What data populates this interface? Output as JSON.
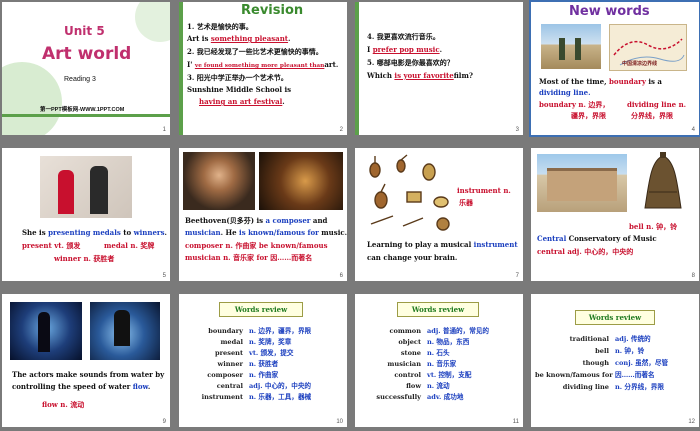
{
  "slides": [
    {
      "num": "1",
      "unit": "Unit 5",
      "title": "Art world",
      "reading": "Reading 3",
      "footer": "第一PPT模板网-WWW.1PPT.COM"
    },
    {
      "num": "2",
      "banner": "Revision",
      "q1": "1. 艺术是愉快的事。",
      "q1a_pre": "Art is ",
      "q1a": "something pleasant",
      "q1a_post": ".",
      "q2": "2. 我已经发现了一些比艺术更愉快的事情。",
      "q2a_pre": "I' ",
      "q2a": "ve found  something more pleasant than",
      "q2a_post": "art.",
      "q3": "3. 阳光中学正举办一个艺术节。",
      "q3b": "Sunshine Middle School is",
      "q3a": "having  an  art festival",
      "q3a_post": "."
    },
    {
      "num": "3",
      "q4": "4. 我更喜欢流行音乐。",
      "q4a_pre": "I ",
      "q4a": "prefer pop music",
      "q4a_post": ".",
      "q5": "5. 哪部电影是你最喜欢的？",
      "q5a_pre": "Which ",
      "q5a": "is your favorite",
      "q5a_post": "film?"
    },
    {
      "num": "4",
      "banner": "New words",
      "map_caption": "中国清凉边界线",
      "l1": "Most of the time, ",
      "l1b": "boundary",
      "l1c": " is a",
      "l2": "dividing line.",
      "w1": "boundary ",
      "w1b": "n. 边界，",
      "w2": "dividing line ",
      "w2b": "n.",
      "w3": "疆界，界限",
      "w4": "分界线，界限"
    },
    {
      "num": "5",
      "l1": "She is ",
      "l1b": "presenting medals",
      "l1c": " to ",
      "l1d": "winners",
      "w1": "present ",
      "w1b": "vt. 颁发",
      "w2": "medal ",
      "w2b": "n. 奖牌",
      "w3": "winner ",
      "w3b": "n. 获胜者"
    },
    {
      "num": "6",
      "l1": "Beethoven(贝多芬) is ",
      "l1b": "a composer",
      "l1c": " and",
      "l2": "musician",
      "l2b": ". He ",
      "l2c": "is known/famous for",
      "l2d": " music.",
      "l3": "composer ",
      "l3b": "n. 作曲家  be known/famous",
      "l4": "musician ",
      "l4b": "n. 音乐家  for  因……而著名"
    },
    {
      "num": "7",
      "w1": "instrument ",
      "w1b": "n.",
      "w2": "乐器",
      "l1": "Learning to play a musical ",
      "l1b": "instrument",
      "l2": "can change your brain."
    },
    {
      "num": "8",
      "w1": "bell ",
      "w1b": "n. 钟，铃",
      "l1": "Central",
      "l1b": " Conservatory of Music",
      "l2": "central ",
      "l2b": "adj. 中心的，中央的"
    },
    {
      "num": "9",
      "l1": "The actors make sounds from water by",
      "l2": "controlling the speed of water ",
      "l2b": "flow",
      "w1": "flow ",
      "w1b": "n. 流动"
    },
    {
      "num": "10",
      "badge": "Words review",
      "rows": [
        [
          "boundary",
          "n. 边界，疆界，界限"
        ],
        [
          "medal",
          "n. 奖牌，奖章"
        ],
        [
          "present",
          "vt. 颁发，提交"
        ],
        [
          "winner",
          "n. 获胜者"
        ],
        [
          "composer",
          "n. 作曲家"
        ],
        [
          "central",
          "adj. 中心的，中央的"
        ],
        [
          "instrument",
          "n. 乐器，工具，器械"
        ]
      ]
    },
    {
      "num": "11",
      "badge": "Words review",
      "rows": [
        [
          "common",
          "adj. 普通的，常见的"
        ],
        [
          "object",
          "n. 物品，东西"
        ],
        [
          "stone",
          "n. 石头"
        ],
        [
          "musician",
          "n. 音乐家"
        ],
        [
          "control",
          "vt. 控制，支配"
        ],
        [
          "flow",
          "n. 流动"
        ],
        [
          "successfully",
          "adv. 成功地"
        ]
      ]
    },
    {
      "num": "12",
      "badge": "Words review",
      "rows": [
        [
          "traditional",
          "adj. 传统的"
        ],
        [
          "bell",
          "n. 钟，铃"
        ],
        [
          "though",
          "conj. 虽然，尽管"
        ],
        [
          "be known/famous for",
          "因……而著名"
        ],
        [
          "dividing line",
          "n. 分界线，界限"
        ]
      ]
    }
  ]
}
